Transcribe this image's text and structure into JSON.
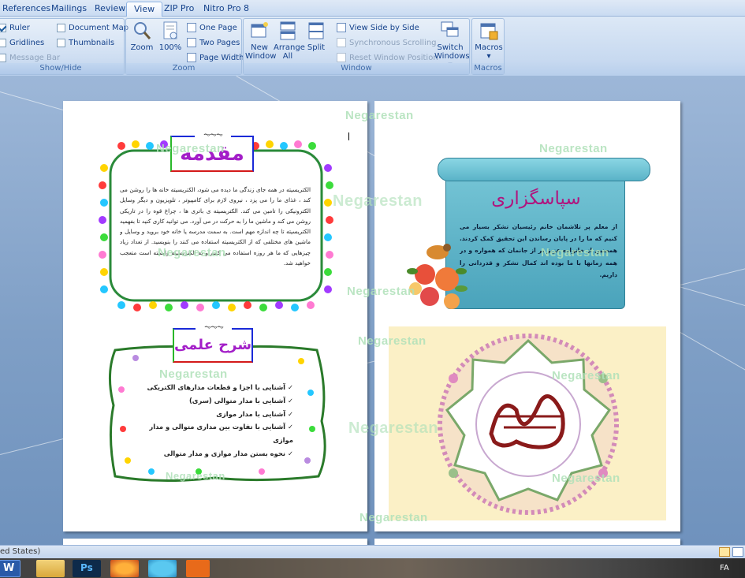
{
  "tabs": [
    {
      "label": "References",
      "active": false
    },
    {
      "label": "Mailings",
      "active": false
    },
    {
      "label": "Review",
      "active": false
    },
    {
      "label": "View",
      "active": true
    },
    {
      "label": "ZIP Pro",
      "active": false
    },
    {
      "label": "Nitro Pro 8",
      "active": false
    }
  ],
  "ribbon": {
    "show_hide": {
      "title": "Show/Hide",
      "ruler": "Ruler",
      "gridlines": "Gridlines",
      "message_bar": "Message Bar",
      "document_map": "Document Map",
      "thumbnails": "Thumbnails"
    },
    "zoom": {
      "title": "Zoom",
      "zoom": "Zoom",
      "hundred": "100%",
      "one_page": "One Page",
      "two_pages": "Two Pages",
      "page_width": "Page Width"
    },
    "window": {
      "title": "Window",
      "new_window_1": "New",
      "new_window_2": "Window",
      "arrange_all_1": "Arrange",
      "arrange_all_2": "All",
      "split": "Split",
      "view_side": "View Side by Side",
      "sync_scroll": "Synchronous Scrolling",
      "reset_pos": "Reset Window Position",
      "switch_1": "Switch",
      "switch_2": "Windows"
    },
    "macros": {
      "title": "Macros",
      "label": "Macros"
    }
  },
  "document": {
    "watermark": "Negarestan",
    "page1": {
      "intro_title": "مقدمه",
      "intro_text": "الکتریسیته در همه جای زندگی ما دیده می شود، الکتریسیته خانه ها را روشن می کند ، غذای ما را می پزد ، نیروی لازم برای کامپیوتر ، تلویزیون و دیگر وسایل الکترونیکی را تامین می کند. الکتریسیته ی باتری ها ، چراغ قوه را در تاریکی روشن می کند و ماشین ما را به حرکت در می آورد. می توانید کاری کنید تا بفهمید الکتریسیته تا چه اندازه مهم است. به سمت مدرسه یا خانه خود بروید و وسایل و ماشین های مختلفی که از الکتریسیته استفاده می کنند را بنویسید. از تعداد زیاد چیزهایی که ما هر روزه استفاده می کنیم و به الکتریسیته وابسته است متعجب خواهید شد.",
      "science_title": "شرح علمی",
      "science_items": [
        "آشنایی با اجزا و قطعات مدارهای الکتریکی",
        "آشنایی با مدار متوالی (سری)",
        "آشنایی با مدار موازی",
        "آشنایی با تفاوت بین مداری متوالی و مدار موازی",
        "نحوه بستن مدار موازی و مدار متوالی"
      ]
    },
    "page2": {
      "thanks_title": "سپاسگزاری",
      "thanks_text": "از معلم پر تلاشمان خانم رئیسیان تشکر بسیار می کنیم که ما را در پایان رساندن این تحقیق کمک کردند. همچنین از خانواده عزیز تر از جانمان که همواره و در همه زمانها با ما بوده اند کمال تشکر و قدردانی را داریم."
    }
  },
  "status": {
    "language": "ed States)"
  },
  "taskbar": {
    "lang": "FA"
  }
}
